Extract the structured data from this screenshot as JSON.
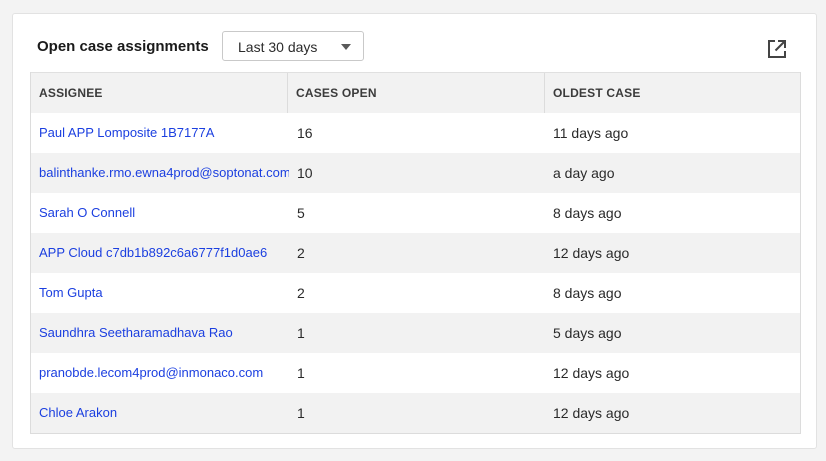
{
  "widget": {
    "title": "Open case assignments",
    "range_selected": "Last 30 days"
  },
  "icons": {
    "dropdown_caret": "chevron-down-icon",
    "external_link": "external-link-icon"
  },
  "table": {
    "columns": [
      "ASSIGNEE",
      "CASES OPEN",
      "OLDEST CASE"
    ],
    "rows": [
      {
        "assignee": "Paul APP Lomposite 1B7177A",
        "cases_open": "16",
        "oldest_case": "11 days ago"
      },
      {
        "assignee": "balinthanke.rmo.ewna4prod@soptonat.com",
        "cases_open": "10",
        "oldest_case": "a day ago"
      },
      {
        "assignee": "Sarah O Connell",
        "cases_open": "5",
        "oldest_case": "8 days ago"
      },
      {
        "assignee": "APP Cloud c7db1b892c6a6777f1d0ae6",
        "cases_open": "2",
        "oldest_case": "12 days ago"
      },
      {
        "assignee": "Tom Gupta",
        "cases_open": "2",
        "oldest_case": "8 days ago"
      },
      {
        "assignee": "Saundhra Seetharamadhava Rao",
        "cases_open": "1",
        "oldest_case": "5 days ago"
      },
      {
        "assignee": "pranobde.lecom4prod@inmonaco.com",
        "cases_open": "1",
        "oldest_case": "12 days ago"
      },
      {
        "assignee": "Chloe Arakon",
        "cases_open": "1",
        "oldest_case": "12 days ago"
      }
    ]
  },
  "colors": {
    "link": "#1b3fe0",
    "header_bg": "#f2f2f2",
    "stripe_bg": "#f2f2f2"
  }
}
